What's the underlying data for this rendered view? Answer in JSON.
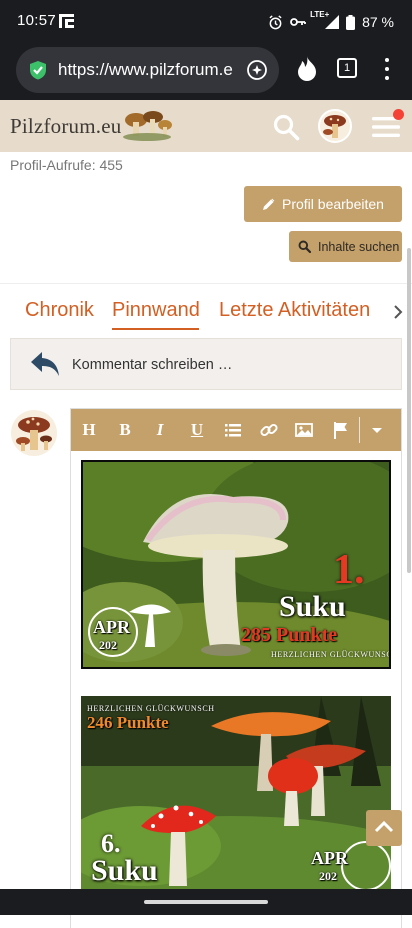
{
  "status_bar": {
    "time": "10:57",
    "network": "LTE+",
    "battery": "87 %"
  },
  "browser": {
    "url": "https://www.pilzforum.e",
    "tab_count": "1"
  },
  "site_header": {
    "logo": "Pilzforum.eu"
  },
  "profile": {
    "views": "Profil-Aufrufe: 455",
    "edit_button": "Profil bearbeiten",
    "search_button": "Inhalte suchen"
  },
  "tabs": [
    {
      "label": "Chronik"
    },
    {
      "label": "Pinnwand"
    },
    {
      "label": "Letzte Aktivitäten"
    }
  ],
  "comment": {
    "placeholder": "Kommentar schreiben …"
  },
  "editor": {
    "toolbar": {
      "heading": "H",
      "bold": "B",
      "italic": "I",
      "underline": "U"
    }
  },
  "images": [
    {
      "rank": "1.",
      "name": "Suku",
      "points": "285 Punkte",
      "congrats": "HERZLICHEN GLÜCKWUNSCH",
      "badge": "APR",
      "badge_year": "202"
    },
    {
      "rank": "6.",
      "name": "Suku",
      "points": "246 Punkte",
      "congrats": "HERZLICHEN GLÜCKWUNSCH",
      "badge": "APR",
      "badge_year": "202"
    }
  ],
  "colors": {
    "accent": "#c4a06a",
    "tab": "#d35f23",
    "header_bg": "#e7dccb",
    "browser_bg": "#1b1c1f"
  }
}
